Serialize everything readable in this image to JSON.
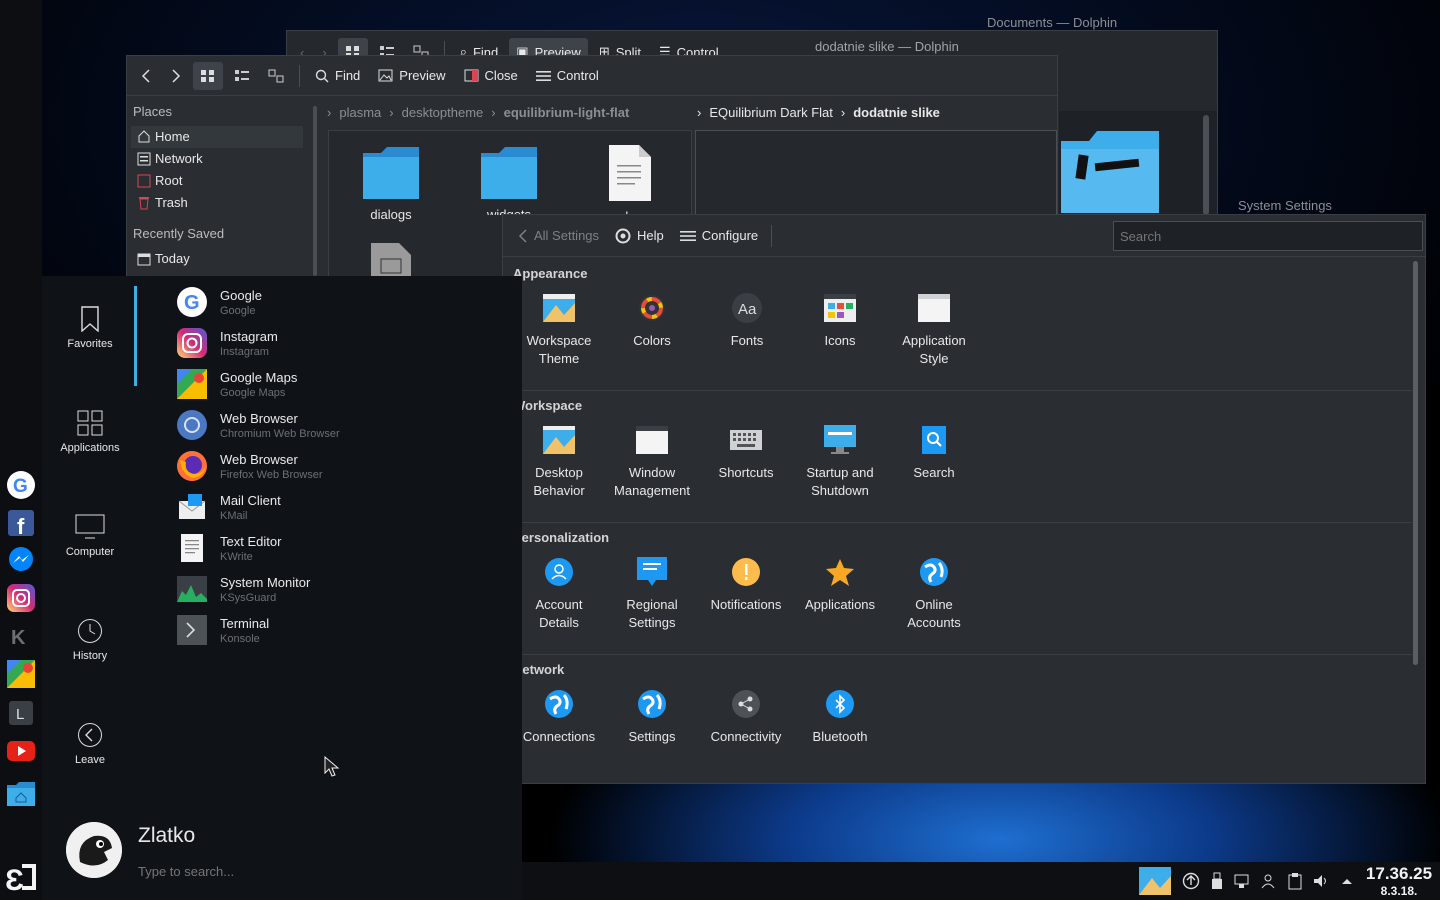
{
  "menu_button_icon": "hamburger-icon",
  "windows": {
    "back_dolphin": {
      "title": "Documents — Dolphin",
      "toolbar": {
        "find": "Find",
        "preview": "Preview",
        "split": "Split",
        "control": "Control"
      }
    },
    "front_dolphin": {
      "title": "dodatnie slike — Dolphin",
      "toolbar": {
        "find": "Find",
        "preview": "Preview",
        "close": "Close",
        "control": "Control"
      },
      "places_header": "Places",
      "places": [
        "Home",
        "Network",
        "Root",
        "Trash"
      ],
      "recent_header": "Recently Saved",
      "recent": [
        "Today"
      ],
      "breadcrumb_left": [
        "plasma",
        "desktoptheme",
        "equilibrium-light-flat"
      ],
      "breadcrumb_right": [
        "EQuilibrium Dark Flat",
        "dodatnie slike"
      ],
      "files": [
        "dialogs",
        "widgets",
        "colors"
      ]
    },
    "settings": {
      "title": "System Settings",
      "all_settings": "All Settings",
      "help": "Help",
      "configure": "Configure",
      "search_placeholder": "Search",
      "sections": [
        {
          "title": "Appearance",
          "items": [
            {
              "label": "Workspace\nTheme",
              "icon": "workspace-theme-icon"
            },
            {
              "label": "Colors",
              "icon": "colors-icon"
            },
            {
              "label": "Fonts",
              "icon": "fonts-icon"
            },
            {
              "label": "Icons",
              "icon": "icons-icon"
            },
            {
              "label": "Application\nStyle",
              "icon": "application-style-icon"
            }
          ]
        },
        {
          "title": "Workspace",
          "items": [
            {
              "label": "Desktop\nBehavior",
              "icon": "desktop-behavior-icon"
            },
            {
              "label": "Window\nManagement",
              "icon": "window-management-icon"
            },
            {
              "label": "Shortcuts",
              "icon": "keyboard-icon"
            },
            {
              "label": "Startup and\nShutdown",
              "icon": "startup-icon"
            },
            {
              "label": "Search",
              "icon": "search-icon"
            }
          ]
        },
        {
          "title": "Personalization",
          "items": [
            {
              "label": "Account\nDetails",
              "icon": "account-icon"
            },
            {
              "label": "Regional\nSettings",
              "icon": "regional-icon"
            },
            {
              "label": "Notifications",
              "icon": "notifications-icon"
            },
            {
              "label": "Applications",
              "icon": "star-icon"
            },
            {
              "label": "Online\nAccounts",
              "icon": "online-accounts-icon"
            }
          ]
        },
        {
          "title": "Network",
          "items": [
            {
              "label": "Connections",
              "icon": "globe-icon"
            },
            {
              "label": "Settings",
              "icon": "globe-icon"
            },
            {
              "label": "Connectivity",
              "icon": "share-icon"
            },
            {
              "label": "Bluetooth",
              "icon": "bluetooth-icon"
            }
          ]
        }
      ]
    }
  },
  "launcher": {
    "side": [
      {
        "label": "Favorites",
        "icon": "bookmark-icon"
      },
      {
        "label": "Applications",
        "icon": "grid-icon"
      },
      {
        "label": "Computer",
        "icon": "monitor-icon"
      },
      {
        "label": "History",
        "icon": "clock-icon"
      },
      {
        "label": "Leave",
        "icon": "back-arrow-icon"
      }
    ],
    "apps": [
      {
        "name": "Google",
        "generic": "Google",
        "icon": "google-icon"
      },
      {
        "name": "Instagram",
        "generic": "Instagram",
        "icon": "instagram-icon"
      },
      {
        "name": "Google Maps",
        "generic": "Google Maps",
        "icon": "maps-icon"
      },
      {
        "name": "Web Browser",
        "generic": "Chromium Web Browser",
        "icon": "chromium-icon"
      },
      {
        "name": "Web Browser",
        "generic": "Firefox Web Browser",
        "icon": "firefox-icon"
      },
      {
        "name": "Mail Client",
        "generic": "KMail",
        "icon": "mail-icon"
      },
      {
        "name": "Text Editor",
        "generic": "KWrite",
        "icon": "text-editor-icon"
      },
      {
        "name": "System Monitor",
        "generic": "KSysGuard",
        "icon": "system-monitor-icon"
      },
      {
        "name": "Terminal",
        "generic": "Konsole",
        "icon": "terminal-icon"
      }
    ],
    "user_name": "Zlatko",
    "search_placeholder": "Type to search..."
  },
  "left_panel_launchers": [
    "google-icon",
    "facebook-icon",
    "messenger-icon",
    "instagram-icon",
    "kde-icon",
    "maps-icon",
    "l-app-icon",
    "youtube-icon",
    "home-folder-icon"
  ],
  "taskbar": {
    "time": "17.36.25",
    "date": "8.3.18."
  }
}
